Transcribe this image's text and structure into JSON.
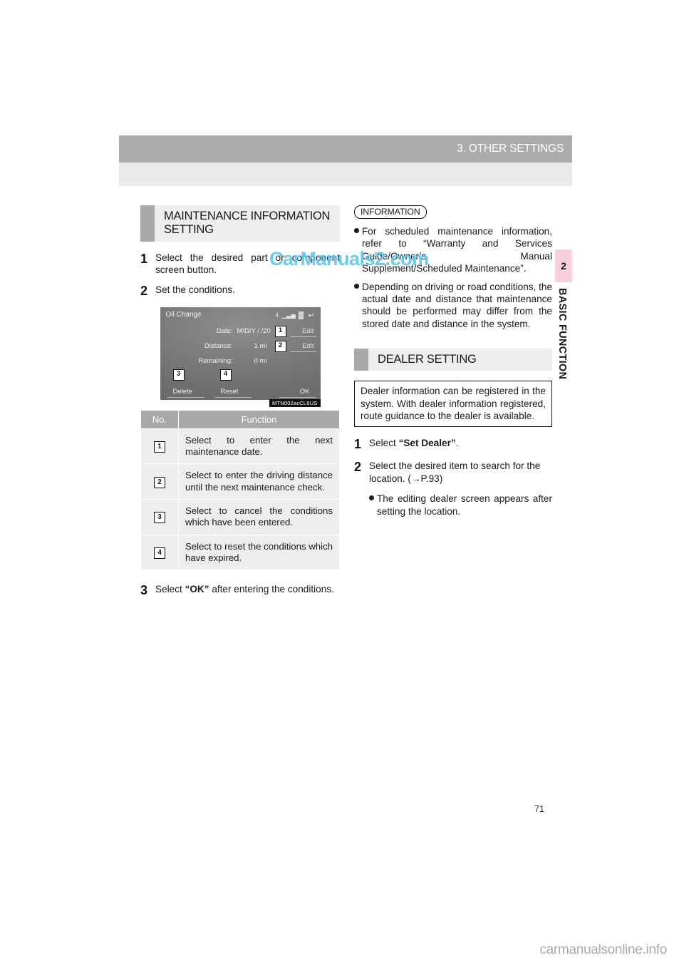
{
  "header": {
    "title": "3. OTHER SETTINGS"
  },
  "chapter_tab": {
    "number": "2",
    "label": "BASIC FUNCTION"
  },
  "left_column": {
    "section_heading": "MAINTENANCE INFORMATION SETTING",
    "steps": [
      {
        "num": "1",
        "text": "Select the desired part or component screen button."
      },
      {
        "num": "2",
        "text": "Set the conditions."
      }
    ],
    "figure": {
      "screen_title": "Oil Change",
      "status_signal": "4",
      "status_bars_icon": "signal-bars-icon",
      "status_battery_icon": "battery-icon",
      "back_icon": "back-arrow-icon",
      "rows": [
        {
          "label": "Date:",
          "value": "M/D/Y      /      /20",
          "action": "Edit"
        },
        {
          "label": "Distance:",
          "value": "1 mi",
          "action": "Edit"
        },
        {
          "label": "Remaining:",
          "value": "0 mi",
          "action": ""
        }
      ],
      "buttons": {
        "delete": "Delete",
        "reset": "Reset",
        "ok": "OK"
      },
      "callouts": [
        "1",
        "2",
        "3",
        "4"
      ],
      "figure_code": "MTN002acCL6US"
    },
    "table": {
      "headers": {
        "no": "No.",
        "function": "Function"
      },
      "rows": [
        {
          "no": "1",
          "function": "Select to enter the next maintenance date."
        },
        {
          "no": "2",
          "function": "Select to enter the driving distance until the next maintenance check."
        },
        {
          "no": "3",
          "function": "Select to cancel the conditions which have been entered."
        },
        {
          "no": "4",
          "function": "Select to reset the conditions which have expired."
        }
      ]
    },
    "step3": {
      "num": "3",
      "pre": "Select ",
      "bold": "“OK”",
      "post": " after entering the conditions."
    }
  },
  "right_column": {
    "information_tag": "INFORMATION",
    "information_bullets": [
      "For scheduled maintenance information, refer to “Warranty and Services Guide/Owner’s Manual Supplement/Scheduled Maintenance”.",
      "Depending on driving or road conditions, the actual date and distance that maintenance should be performed may differ from the stored date and distance in the system."
    ],
    "section_heading": "DEALER SETTING",
    "dealer_box": "Dealer information can be registered in the system. With dealer information registered, route guidance to the dealer is available.",
    "steps": [
      {
        "num": "1",
        "pre": "Select ",
        "bold": "“Set Dealer”",
        "post": "."
      },
      {
        "num": "2",
        "pre": "Select the desired item to search for the location. (",
        "bold": "",
        "post": "→P.93)"
      }
    ],
    "bullet": "The editing dealer screen appears after setting the location."
  },
  "page_number": "71",
  "watermark": "CarManuals2.com",
  "footer_watermark": "carmanualsonline.info",
  "colors": {
    "header_band": "#ababab",
    "header_subband": "#eaeaea",
    "section_bg": "#ededed",
    "swatch": "#a8a8a8",
    "tab_pink": "#f9cfe0",
    "watermark_blue": "#5ec8f0"
  }
}
